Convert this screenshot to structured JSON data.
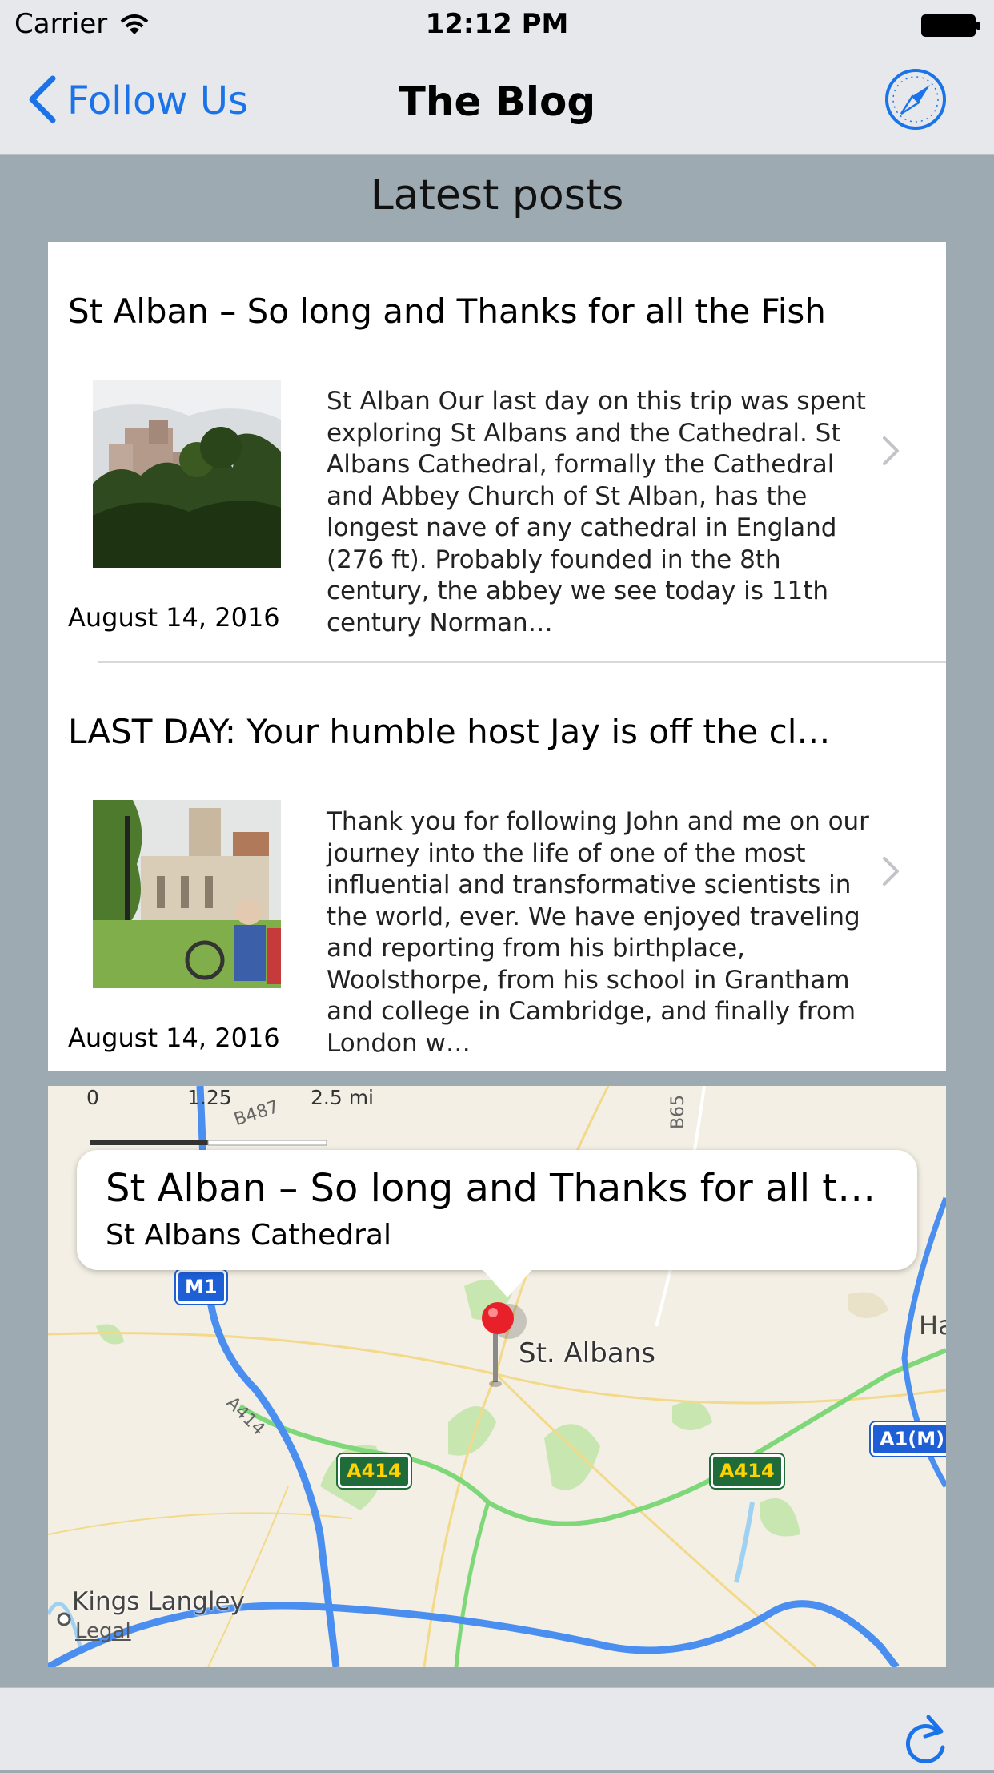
{
  "status_bar": {
    "carrier": "Carrier",
    "time": "12:12 PM"
  },
  "nav": {
    "back_label": "Follow Us",
    "title": "The Blog",
    "right_icon": "safari-compass-icon"
  },
  "section_title": "Latest posts",
  "posts": [
    {
      "title": "St Alban – So long and Thanks for all the Fish",
      "excerpt": "St Alban Our last day on this trip was spent exploring St Albans and the Cathedral. St Albans Cathedral, formally the Cathedral and Abbey Church of St Alban, has the longest nave of any cathedral in England (276 ft). Probably founded in the 8th century, the abbey we see today is 11th century Norman…",
      "date": "August 14, 2016"
    },
    {
      "title": "LAST DAY: Your humble host Jay is off the cl…",
      "excerpt": "Thank you for following John and me on our journey into the life of one of the most influential and transformative scientists in the world, ever. We have enjoyed traveling and reporting from his birthplace, Woolsthorpe, from his school in Grantham and college in Cambridge, and finally from London w…",
      "date": "August 14, 2016"
    }
  ],
  "map": {
    "callout_title": "St Alban – So long and Thanks for all the…",
    "callout_subtitle": "St Albans Cathedral",
    "scale": {
      "zero": "0",
      "mid": "1.25",
      "max": "2.5 mi"
    },
    "city_label": "St. Albans",
    "town_label": "Kings Langley",
    "edge_label": "Ha",
    "legal": "Legal",
    "shields": {
      "m1": "M1",
      "a414_1": "A414",
      "a414_2": "A414",
      "a1m": "A1(M)"
    },
    "road_labels": {
      "b487": "B487",
      "b65": "B65",
      "a414_road": "A414"
    },
    "colors": {
      "motorway": "#4a8ef0",
      "primary": "#7ed87a",
      "land": "#f3efe4",
      "park": "#c8e6b0"
    }
  },
  "toolbar": {
    "refresh_icon": "refresh-icon"
  },
  "colors": {
    "accent": "#1a73e8",
    "background": "#9daab1",
    "bar": "#e6e8eb"
  }
}
